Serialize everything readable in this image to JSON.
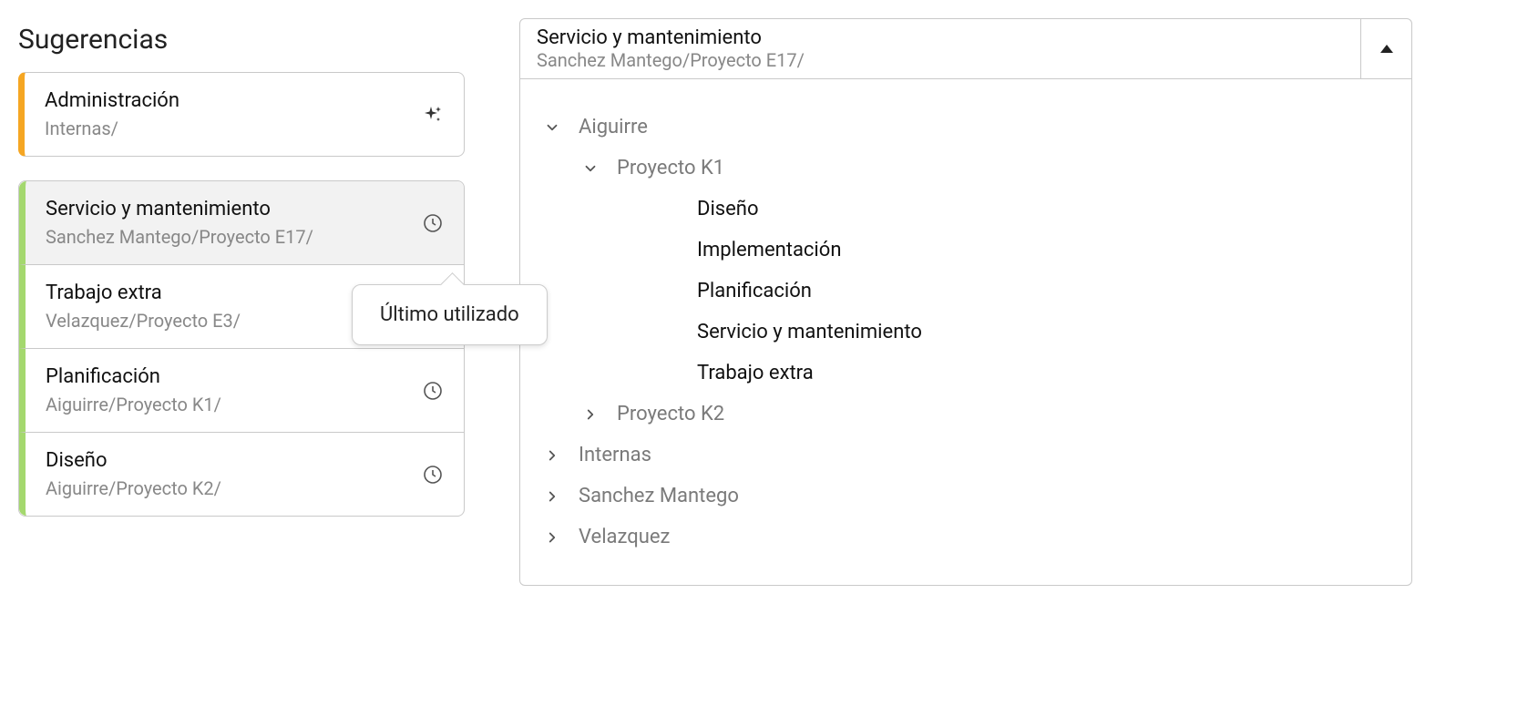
{
  "sugerencias": {
    "heading": "Sugerencias",
    "ai_card": {
      "title": "Administración",
      "sub": "Internas/"
    },
    "tooltip": "Último utilizado",
    "items": [
      {
        "title": "Servicio y mantenimiento",
        "sub": "Sanchez Mantego/Proyecto E17/",
        "highlight": true
      },
      {
        "title": "Trabajo extra",
        "sub": "Velazquez/Proyecto E3/"
      },
      {
        "title": "Planificación",
        "sub": "Aiguirre/Proyecto K1/"
      },
      {
        "title": "Diseño",
        "sub": "Aiguirre/Proyecto K2/"
      }
    ]
  },
  "picker": {
    "selected": {
      "title": "Servicio y mantenimiento",
      "sub": "Sanchez Mantego/Proyecto E17/"
    },
    "tree": {
      "aiguirre": "Aiguirre",
      "proyecto_k1": "Proyecto K1",
      "k1_children": [
        "Diseño",
        "Implementación",
        "Planificación",
        "Servicio y mantenimiento",
        "Trabajo extra"
      ],
      "proyecto_k2": "Proyecto K2",
      "internas": "Internas",
      "sanchez": "Sanchez Mantego",
      "velazquez": "Velazquez"
    }
  }
}
